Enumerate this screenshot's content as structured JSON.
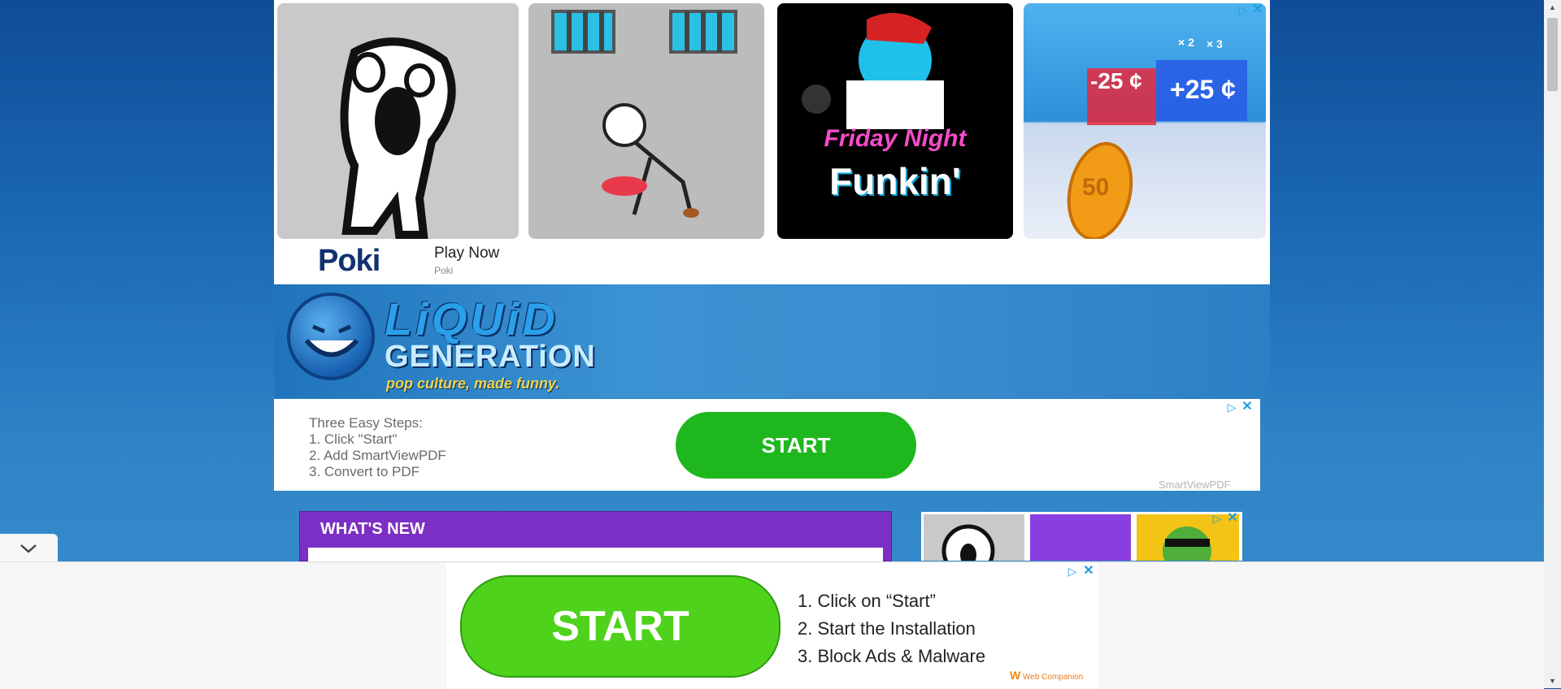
{
  "top_ad": {
    "brand": "Poki",
    "cta": "Play Now",
    "sub": "Poki",
    "tile3_title_line1": "Friday Night",
    "tile3_title_line2": "Funkin'",
    "tile4_minus": "-25 ¢",
    "tile4_plus": "+25 ¢",
    "tile4_x2": "× 2",
    "tile4_x3": "× 3",
    "tile4_coin": "50"
  },
  "site": {
    "logo_line1": "LiQUiD",
    "logo_line2": "GENERATiON",
    "tagline": "pop culture, made funny."
  },
  "mid_ad": {
    "steps": [
      "Three Easy Steps:",
      "1. Click \"Start\"",
      "2. Add SmartViewPDF",
      "3. Convert to PDF"
    ],
    "button": "START",
    "advertiser": "SmartViewPDF"
  },
  "whats_new": {
    "title": "WHAT'S NEW"
  },
  "bottom_ad": {
    "button": "START",
    "steps": [
      "1. Click on “Start”",
      "2. Start the Installation",
      "3. Block Ads & Malware"
    ],
    "advertiser": "Web Companion"
  },
  "colors": {
    "accent_green": "#1fb71e",
    "purple": "#7b2fc4",
    "page_blue": "#1c6bb5"
  }
}
